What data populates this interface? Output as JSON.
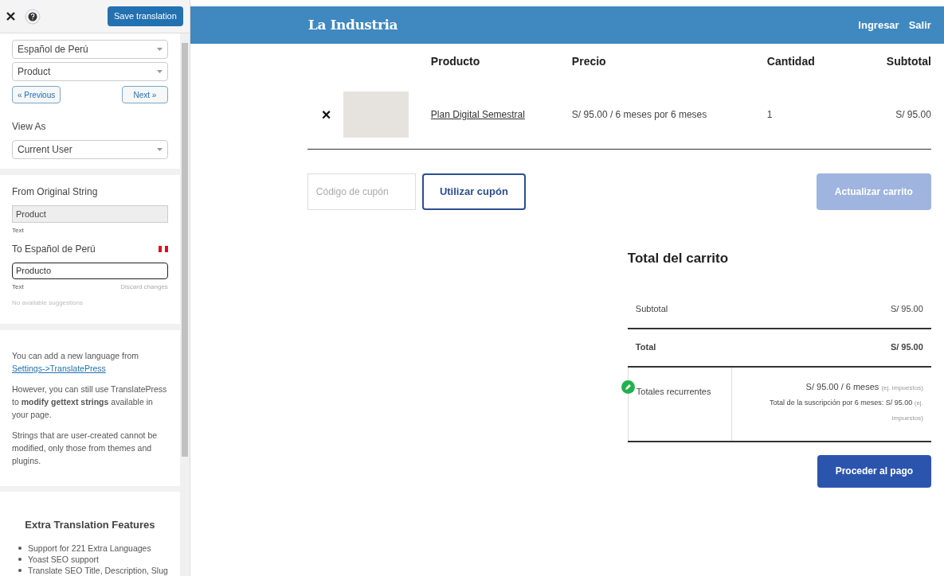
{
  "sidebar": {
    "save_button": "Save translation",
    "language_select": "Español de Perú",
    "string_select": "Product",
    "previous_button": "« Previous",
    "next_button": "Next »",
    "view_as_label": "View As",
    "view_as_select": "Current User",
    "from_label": "From Original String",
    "from_value": "Product",
    "from_type": "Text",
    "to_label": "To Español de Perú",
    "to_value": "Producto",
    "to_type": "Text",
    "discard": "Discard changes",
    "suggestions": "No available suggestions",
    "info_text": "You can add a new language from",
    "info_link": "Settings->TranslatePress",
    "info_2": "However, you can still use TranslatePress to **modify gettext strings** available in your page.",
    "info_3": "Strings that are user-created cannot be modified, only those from themes and plugins.",
    "features_title": "Extra Translation Features",
    "features": [
      "Support for 221 Extra Languages",
      "Yoast SEO support",
      "Translate SEO Title, Description, Slug"
    ]
  },
  "header": {
    "logo": "La Industria",
    "links": [
      "Ingresar",
      "Salir"
    ]
  },
  "cart": {
    "columns": [
      "Producto",
      "Precio",
      "Cantidad",
      "Subtotal"
    ],
    "rows": [
      {
        "remove": "×",
        "product": "Plan Digital Semestral",
        "price": "S/ 95.00 / 6 meses por 6 meses",
        "quantity": "1",
        "subtotal": "S/ 95.00"
      }
    ],
    "coupon_placeholder": "Código de cupón",
    "coupon_button": "Utilizar cupón",
    "update_button": "Actualizar carrito",
    "update_disabled": true
  },
  "totals": {
    "title": "Total del carrito",
    "rows": [
      {
        "label": "Subtotal",
        "value": "S/ 95.00",
        "bold": false
      },
      {
        "label": "Total",
        "value": "S/ 95.00",
        "bold": true
      }
    ],
    "recurring_label": "Totales recurrentes",
    "recurring_lines": [
      {
        "amount": "S/ 95.00 / 6 meses",
        "note": "(ej. impuestos)"
      },
      {
        "amount": "Total de la suscripción por 6 meses: S/ 95.00",
        "note": "(ej. impuestos)"
      }
    ],
    "checkout_button": "Proceder al pago"
  }
}
